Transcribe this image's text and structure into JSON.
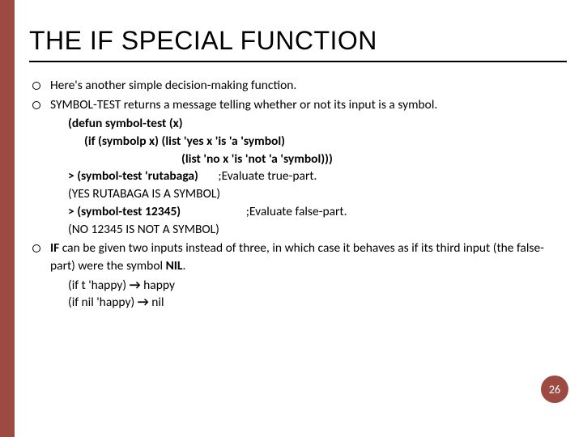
{
  "title": "THE IF SPECIAL FUNCTION",
  "bullets": {
    "b1": "Here's another simple decision-making function.",
    "b2_pre": "SYMBOL-TEST",
    "b2_post": " returns a message telling whether or not its input is a symbol.",
    "b3_pre": "IF",
    "b3_mid": " can be given two inputs instead of three, in which case it behaves as if its third input (the false-part) were the symbol ",
    "b3_nil": "NIL",
    "b3_end": "."
  },
  "code": {
    "l1": "(defun symbol-test (x)",
    "l2": "(if (symbolp x) (list 'yes x 'is 'a 'symbol)",
    "l3": "(list 'no x 'is 'not 'a 'symbol)))",
    "l4a": "> (symbol-test 'rutabaga)",
    "l4b": "       ;Evaluate true-part.",
    "l5": "(YES RUTABAGA IS A SYMBOL)",
    "l6a": "> (symbol-test 12345)",
    "l6b": "                       ;Evaluate false-part.",
    "l7": "(NO 12345 IS NOT A SYMBOL)",
    "l8a": "(if t 'happy) ",
    "l8b": " happy",
    "l9a": "(if nil 'happy) ",
    "l9b": " nil"
  },
  "arrow": "→",
  "page_number": "26"
}
